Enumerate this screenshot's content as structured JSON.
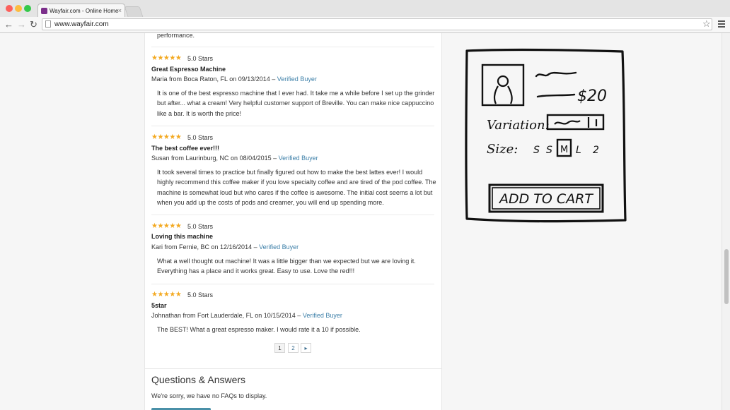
{
  "browser": {
    "tab_title": "Wayfair.com - Online Home",
    "url": "www.wayfair.com",
    "tab_close": "×",
    "back": "←",
    "forward": "→",
    "reload": "↻",
    "bookmark": "☆"
  },
  "reviews": {
    "prev_tail": "performance.",
    "stars": "★★★★★",
    "items": [
      {
        "rating": "5.0 Stars",
        "title": "Great Espresso Machine",
        "author": "Maria from Boca Raton, FL on 09/13/2014 –",
        "verified": "Verified Buyer",
        "body": "It is one of the best espresso machine that I ever had. It take me a while before I set up the grinder but after... what a cream! Very helpful customer support of Breville. You can make nice cappuccino like a bar. It is worth the price!"
      },
      {
        "rating": "5.0 Stars",
        "title": "The best coffee ever!!!",
        "author": "Susan from Laurinburg, NC on 08/04/2015 –",
        "verified": "Verified Buyer",
        "body": "It took several times to practice but finally figured out how to make the best lattes ever! I would highly recommend this coffee maker if you love specialty coffee and are tired of the pod coffee. The machine is somewhat loud but who cares if the coffee is awesome. The initial cost seems a lot but when you add up the costs of pods and creamer, you will end up spending more."
      },
      {
        "rating": "5.0 Stars",
        "title": "Loving this machine",
        "author": "Kari from Fernie, BC on 12/16/2014 –",
        "verified": "Verified Buyer",
        "body": "What a well thought out machine! It was a little bigger than we expected but we are loving it. Everything has a place and it works great. Easy to use. Love the red!!!"
      },
      {
        "rating": "5.0 Stars",
        "title": "5star",
        "author": "Johnathan from Fort Lauderdale, FL on 10/15/2014 –",
        "verified": "Verified Buyer",
        "body": "The BEST! What a great espresso maker. I would rate it a 10 if possible."
      }
    ],
    "pagination": [
      "1",
      "2",
      "▸"
    ]
  },
  "qa": {
    "title": "Questions & Answers",
    "empty_text": "We're sorry, we have no FAQs to display."
  },
  "sketch": {
    "price": "$20",
    "variation_label": "Variation:",
    "size_label": "Size:",
    "sizes": [
      "S",
      "S",
      "M",
      "L",
      "2"
    ],
    "add_to_cart": "ADD TO CART"
  }
}
